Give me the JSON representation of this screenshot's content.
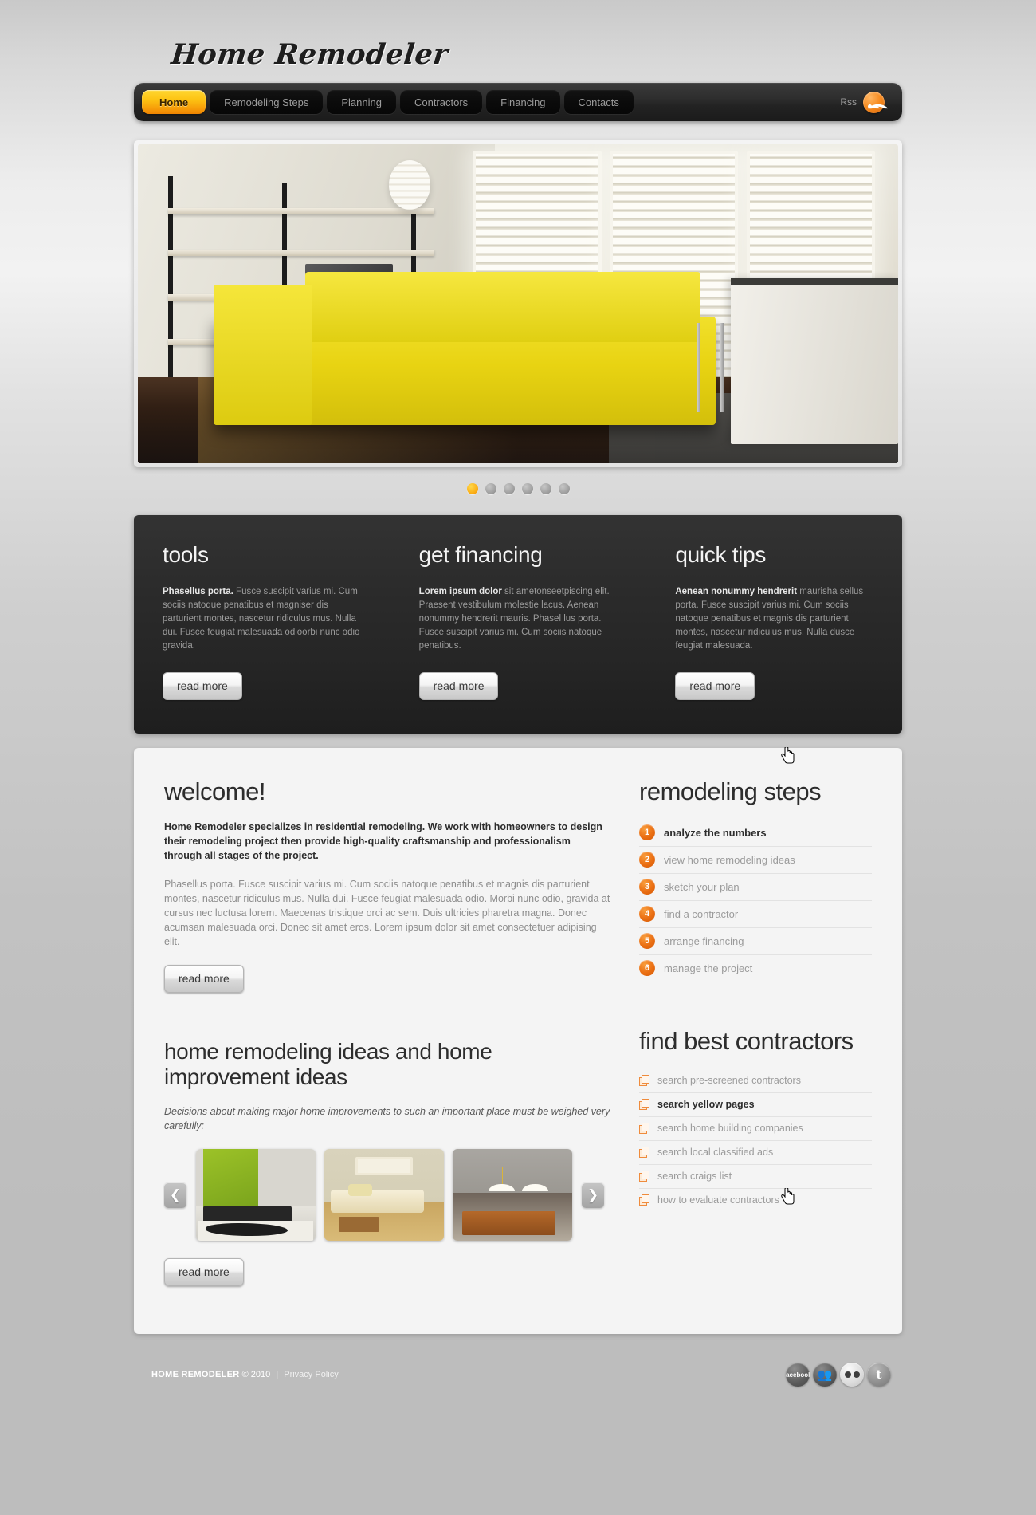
{
  "site": {
    "logo": "Home Remodeler"
  },
  "nav": {
    "items": [
      {
        "label": "Home",
        "active": true
      },
      {
        "label": "Remodeling Steps",
        "active": false
      },
      {
        "label": "Planning",
        "active": false
      },
      {
        "label": "Contractors",
        "active": false
      },
      {
        "label": "Financing",
        "active": false
      },
      {
        "label": "Contacts",
        "active": false
      }
    ],
    "rss_label": "Rss",
    "rss_icon": "rss-icon",
    "accent_color": "#f79f09"
  },
  "slider": {
    "dots": [
      {
        "active": true
      },
      {
        "active": false
      },
      {
        "active": false
      },
      {
        "active": false
      },
      {
        "active": false
      },
      {
        "active": false
      }
    ],
    "active_color": "#fbb018"
  },
  "promos": [
    {
      "title": "tools",
      "lead": "Phasellus porta.",
      "text": " Fusce suscipit varius mi. Cum sociis natoque penatibus et magniser dis parturient montes, nascetur ridiculus mus. Nulla dui. Fusce feugiat malesuada odioorbi nunc odio gravida.",
      "button": "read more"
    },
    {
      "title": "get financing",
      "lead": "Lorem ipsum dolor",
      "text": " sit ametonseetpiscing elit. Praesent vestibulum molestie lacus. Aenean nonummy hendrerit mauris. Phasel lus porta. Fusce suscipit varius mi. Cum sociis natoque penatibus.",
      "button": "read more"
    },
    {
      "title": "quick tips",
      "lead": "Aenean nonummy hendrerit",
      "text": " maurisha sellus porta. Fusce suscipit varius mi. Cum sociis natoque penatibus et magnis dis parturient montes, nascetur ridiculus mus. Nulla dusce feugiat malesuada.",
      "button": "read more"
    }
  ],
  "welcome": {
    "title": "welcome!",
    "lead": "Home Remodeler specializes in residential remodeling. We work with homeowners to design their remodeling project then provide high-quality craftsmanship and professionalism through all stages of the project.",
    "body": "Phasellus porta. Fusce suscipit varius mi. Cum sociis natoque penatibus et magnis dis parturient montes, nascetur ridiculus mus. Nulla dui. Fusce feugiat malesuada odio. Morbi nunc odio, gravida at cursus nec luctusa lorem. Maecenas tristique orci ac sem. Duis ultricies pharetra magna. Donec acumsan malesuada orci. Donec sit amet eros. Lorem ipsum dolor sit amet consectetuer adipising elit.",
    "button": "read more"
  },
  "ideas": {
    "title": "home remodeling ideas and home improvement ideas",
    "subtitle": "Decisions about making major home improvements to such an important place must be weighed very carefully:",
    "prev_icon": "chevron-left-icon",
    "next_icon": "chevron-right-icon",
    "button": "read more"
  },
  "steps": {
    "title": "remodeling steps",
    "items": [
      {
        "num": "1",
        "label": "analyze the numbers",
        "active": true
      },
      {
        "num": "2",
        "label": "view home remodeling ideas",
        "active": false
      },
      {
        "num": "3",
        "label": "sketch your plan",
        "active": false
      },
      {
        "num": "4",
        "label": "find a contractor",
        "active": false
      },
      {
        "num": "5",
        "label": "arrange financing",
        "active": false
      },
      {
        "num": "6",
        "label": "manage the project",
        "active": false
      }
    ],
    "badge_color": "#ea6e12"
  },
  "contractors": {
    "title": "find best contractors",
    "items": [
      {
        "label": "search pre-screened contractors",
        "active": false
      },
      {
        "label": "search yellow pages",
        "active": true
      },
      {
        "label": "search home building companies",
        "active": false
      },
      {
        "label": "search local classified ads",
        "active": false
      },
      {
        "label": "search craigs list",
        "active": false
      },
      {
        "label": "how to evaluate contractors",
        "active": false
      }
    ],
    "icon": "document-copy-icon"
  },
  "footer": {
    "brand": "HOME REMODELER",
    "copyright": "© 2010",
    "separator": "|",
    "privacy": "Privacy Policy",
    "socials": [
      {
        "name": "facebook-icon",
        "label": "facebook"
      },
      {
        "name": "myspace-icon",
        "label": ""
      },
      {
        "name": "flickr-icon",
        "label": ""
      },
      {
        "name": "twitter-icon",
        "label": "t"
      }
    ]
  }
}
